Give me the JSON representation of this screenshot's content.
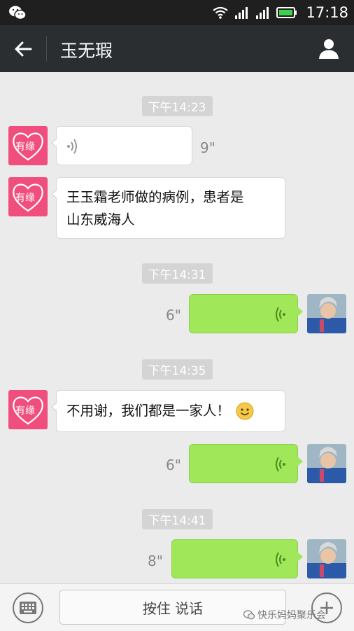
{
  "status_bar": {
    "time": "17:18"
  },
  "header": {
    "title": "玉无瑕"
  },
  "messages": [
    {
      "kind": "timestamp",
      "text": "下午14:23"
    },
    {
      "kind": "voice_in",
      "duration": "9\""
    },
    {
      "kind": "text_in",
      "lines": [
        "王玉霜老师做的病例，患者是",
        "山东威海人"
      ]
    },
    {
      "kind": "timestamp",
      "text": "下午14:31"
    },
    {
      "kind": "voice_out",
      "duration": "6\""
    },
    {
      "kind": "timestamp",
      "text": "下午14:35"
    },
    {
      "kind": "text_in",
      "text": "不用谢，我们都是一家人！",
      "emoji": "smile"
    },
    {
      "kind": "voice_out",
      "duration": "6\""
    },
    {
      "kind": "timestamp",
      "text": "下午14:41"
    },
    {
      "kind": "voice_out",
      "duration": "8\""
    }
  ],
  "input_bar": {
    "hold_to_talk_label": "按住 说话"
  },
  "watermark": {
    "text": "快乐妈妈聚乐会"
  },
  "colors": {
    "header_bg": "#2a2e31",
    "outgoing_bubble": "#a0e759",
    "incoming_bubble": "#ffffff",
    "avatar_pink": "#f04e7c"
  },
  "icons": [
    "wechat-icon",
    "wifi-icon",
    "signal-icon",
    "battery-icon",
    "back-arrow-icon",
    "contact-profile-icon",
    "voice-wave-icon",
    "keyboard-icon",
    "plus-icon",
    "smile-emoji-icon"
  ]
}
